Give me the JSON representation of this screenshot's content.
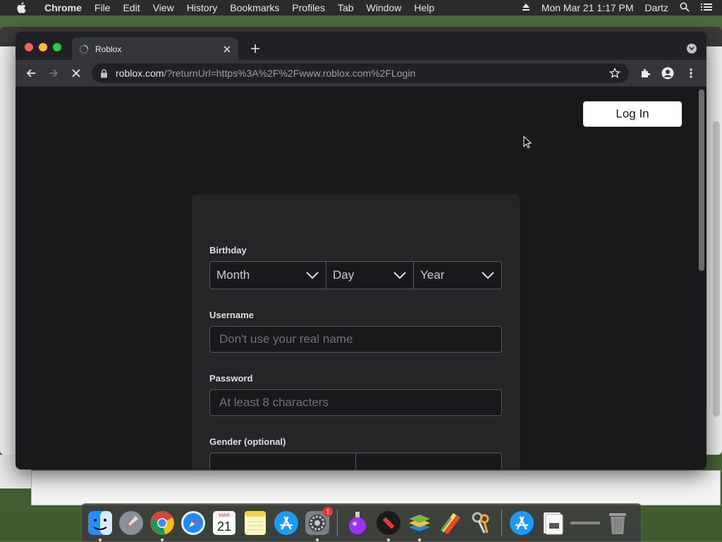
{
  "menubar": {
    "app_name": "Chrome",
    "items": [
      "File",
      "Edit",
      "View",
      "History",
      "Bookmarks",
      "Profiles",
      "Tab",
      "Window",
      "Help"
    ],
    "datetime": "Mon Mar 21  1:17 PM",
    "user": "Dartz"
  },
  "browser": {
    "tab_title": "Roblox",
    "url_domain": "roblox.com",
    "url_path": "/?returnUrl=https%3A%2F%2Fwww.roblox.com%2FLogin"
  },
  "page": {
    "login_button": "Log In",
    "birthday_label": "Birthday",
    "month_placeholder": "Month",
    "day_placeholder": "Day",
    "year_placeholder": "Year",
    "username_label": "Username",
    "username_placeholder": "Don't use your real name",
    "password_label": "Password",
    "password_placeholder": "At least 8 characters",
    "gender_label": "Gender (optional)"
  },
  "dock": {
    "items": [
      {
        "icon": "finder-icon"
      },
      {
        "icon": "launchpad-icon"
      },
      {
        "icon": "chrome-icon"
      },
      {
        "icon": "safari-icon"
      },
      {
        "icon": "calendar-icon",
        "month": "MAR",
        "day": "21"
      },
      {
        "icon": "notes-icon"
      },
      {
        "icon": "app-store-icon"
      },
      {
        "icon": "system-preferences-icon",
        "badge": "1"
      },
      {
        "icon": "potion-icon"
      },
      {
        "icon": "roblox-icon"
      },
      {
        "icon": "bluestacks-icon"
      },
      {
        "icon": "colorful-app-icon"
      },
      {
        "icon": "keychain-icon"
      },
      {
        "icon": "app-store-icon"
      },
      {
        "icon": "files-icon"
      },
      {
        "icon": "minimized-window-icon"
      },
      {
        "icon": "trash-icon"
      }
    ]
  },
  "colors": {
    "page_bg": "#18191b",
    "card_bg": "#232527",
    "login_bg": "#ffffff"
  }
}
